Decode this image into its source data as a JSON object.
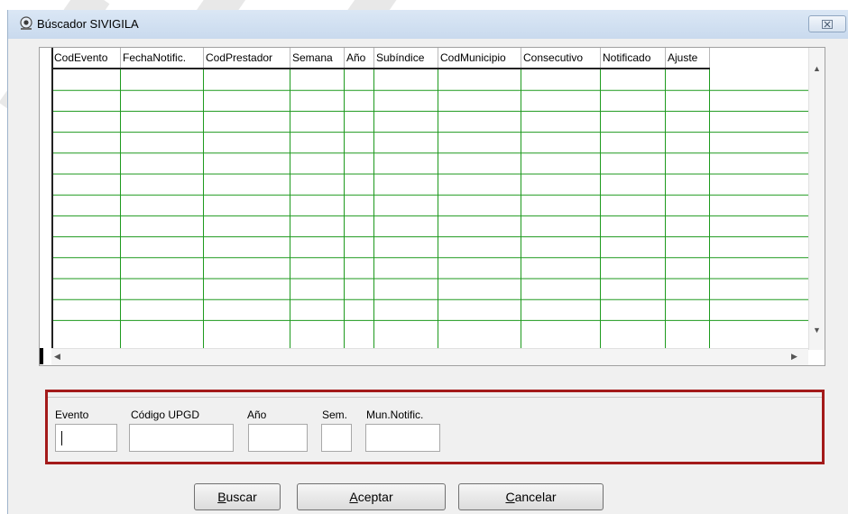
{
  "window": {
    "title": "Búscador SIVIGILA",
    "close_glyph": "☒"
  },
  "grid": {
    "columns": [
      "CodEvento",
      "FechaNotific.",
      "CodPrestador",
      "Semana",
      "Año",
      "Subíndice",
      "CodMunicipio",
      "Consecutivo",
      "Notificado",
      "Ajuste"
    ],
    "row_count": 12,
    "gridline_color": "#1e9a1e",
    "scroll_up": "▲",
    "scroll_down": "▼",
    "scroll_left": "◀",
    "scroll_right": "▶"
  },
  "filters": {
    "evento_label": "Evento",
    "evento_value": "",
    "upgd_label": "Código UPGD",
    "upgd_value": "",
    "anio_label": "Año",
    "anio_value": "",
    "sem_label": "Sem.",
    "sem_value": "",
    "mun_label": "Mun.Notific.",
    "mun_value": "",
    "border_color": "#a31a1a"
  },
  "buttons": {
    "buscar_mnemonic": "B",
    "buscar_rest": "uscar",
    "aceptar_mnemonic": "A",
    "aceptar_rest": "ceptar",
    "cancelar_mnemonic": "C",
    "cancelar_rest": "ancelar"
  }
}
